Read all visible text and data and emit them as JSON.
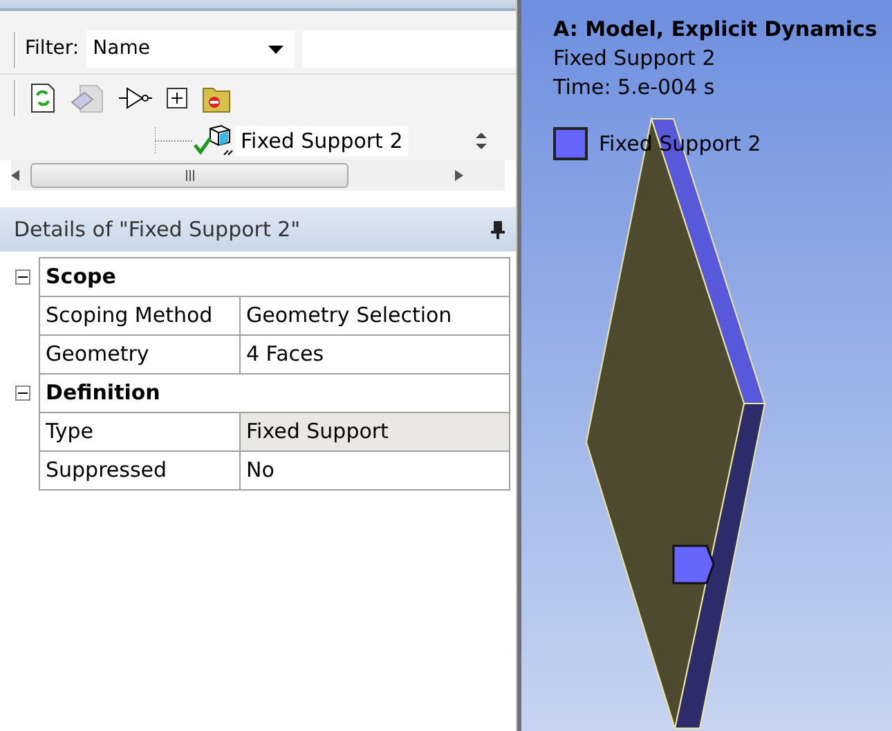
{
  "outline": {
    "filter_label": "Filter:",
    "filter_value": "Name",
    "tree_item": {
      "label": "Fixed Support 2"
    }
  },
  "details": {
    "title": "Details of \"Fixed Support 2\"",
    "sections": [
      {
        "title": "Scope",
        "expanded": true,
        "rows": [
          {
            "name": "Scoping Method",
            "value": "Geometry Selection",
            "highlighted": false
          },
          {
            "name": "Geometry",
            "value": "4 Faces",
            "highlighted": false
          }
        ]
      },
      {
        "title": "Definition",
        "expanded": true,
        "rows": [
          {
            "name": "Type",
            "value": "Fixed Support",
            "highlighted": true
          },
          {
            "name": "Suppressed",
            "value": "No",
            "highlighted": false
          }
        ]
      }
    ]
  },
  "viewport": {
    "title": "A: Model, Explicit Dynamics",
    "subtitle": "Fixed Support 2",
    "time": "Time: 5.e-004 s",
    "legend": [
      {
        "label": "Fixed Support 2",
        "color": "#6666ff"
      }
    ]
  }
}
